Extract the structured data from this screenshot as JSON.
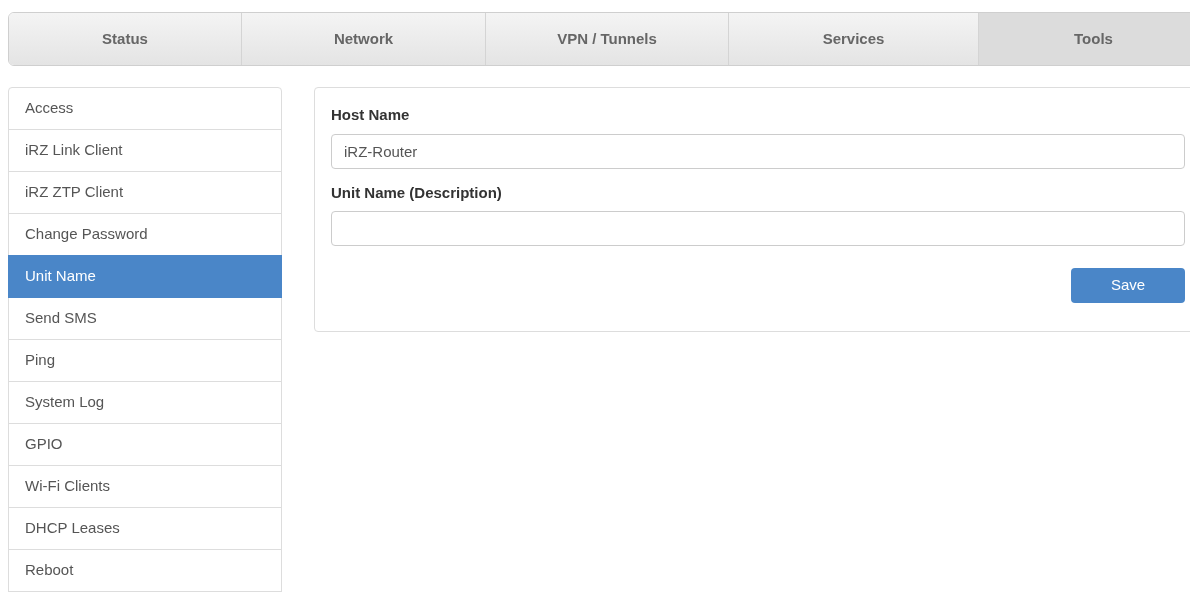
{
  "tabs": [
    {
      "label": "Status",
      "selected": false
    },
    {
      "label": "Network",
      "selected": false
    },
    {
      "label": "VPN / Tunnels",
      "selected": false
    },
    {
      "label": "Services",
      "selected": false
    },
    {
      "label": "Tools",
      "selected": true
    }
  ],
  "sidebar": {
    "items": [
      {
        "label": "Access",
        "selected": false
      },
      {
        "label": "iRZ Link Client",
        "selected": false
      },
      {
        "label": "iRZ ZTP Client",
        "selected": false
      },
      {
        "label": "Change Password",
        "selected": false
      },
      {
        "label": "Unit Name",
        "selected": true
      },
      {
        "label": "Send SMS",
        "selected": false
      },
      {
        "label": "Ping",
        "selected": false
      },
      {
        "label": "System Log",
        "selected": false
      },
      {
        "label": "GPIO",
        "selected": false
      },
      {
        "label": "Wi-Fi Clients",
        "selected": false
      },
      {
        "label": "DHCP Leases",
        "selected": false
      },
      {
        "label": "Reboot",
        "selected": false
      }
    ]
  },
  "form": {
    "fields": [
      {
        "label": "Host Name",
        "value": "iRZ-Router"
      },
      {
        "label": "Unit Name (Description)"
      }
    ],
    "save_button": "Save"
  }
}
